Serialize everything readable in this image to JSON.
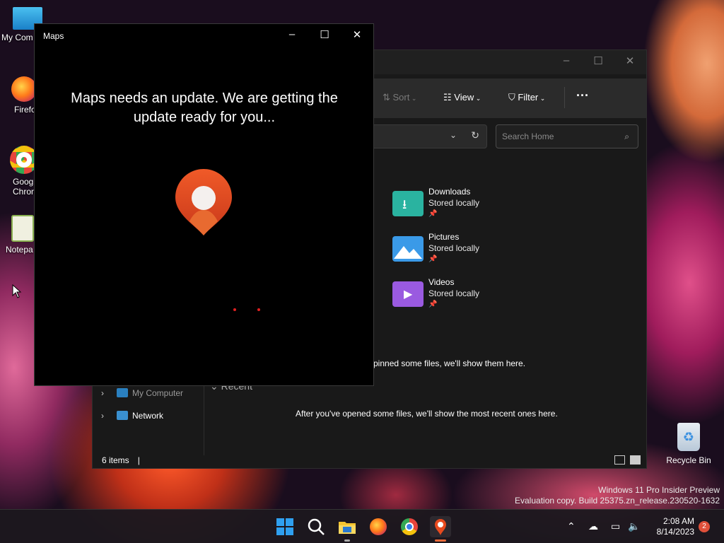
{
  "desktop": {
    "icons": [
      {
        "label": "My Com"
      },
      {
        "label": "Firefo"
      },
      {
        "label": "Goog\nChron"
      },
      {
        "label": "Notepa"
      }
    ],
    "recycle_bin_label": "Recycle Bin",
    "watermark_line1": "Windows 11 Pro Insider Preview",
    "watermark_line2": "Evaluation copy. Build 25375.zn_release.230520-1632"
  },
  "maps_window": {
    "title": "Maps",
    "headline": "Maps needs an update. We are getting the update ready for you...",
    "brand_color": "#e04a1e"
  },
  "explorer": {
    "toolbar": {
      "sort_label": "Sort",
      "view_label": "View",
      "filter_label": "Filter",
      "more_label": "···"
    },
    "search_placeholder": "Search Home",
    "folders": [
      {
        "name": "Downloads",
        "status": "Stored locally",
        "color": "#2ab3a0"
      },
      {
        "name": "Pictures",
        "status": "Stored locally",
        "color": "#3a9ae8"
      },
      {
        "name": "Videos",
        "status": "Stored locally",
        "color": "#9a5ae0"
      }
    ],
    "pinned_message": "pinned some files, we'll show them here.",
    "recent_heading": "Recent",
    "recent_message": "After you've opened some files, we'll show the most recent ones here.",
    "nav_items": [
      {
        "label": "My Computer"
      },
      {
        "label": "Network"
      }
    ],
    "status_items": "6 items"
  },
  "taskbar": {
    "time": "2:08 AM",
    "date": "8/14/2023",
    "notification_count": "2"
  }
}
